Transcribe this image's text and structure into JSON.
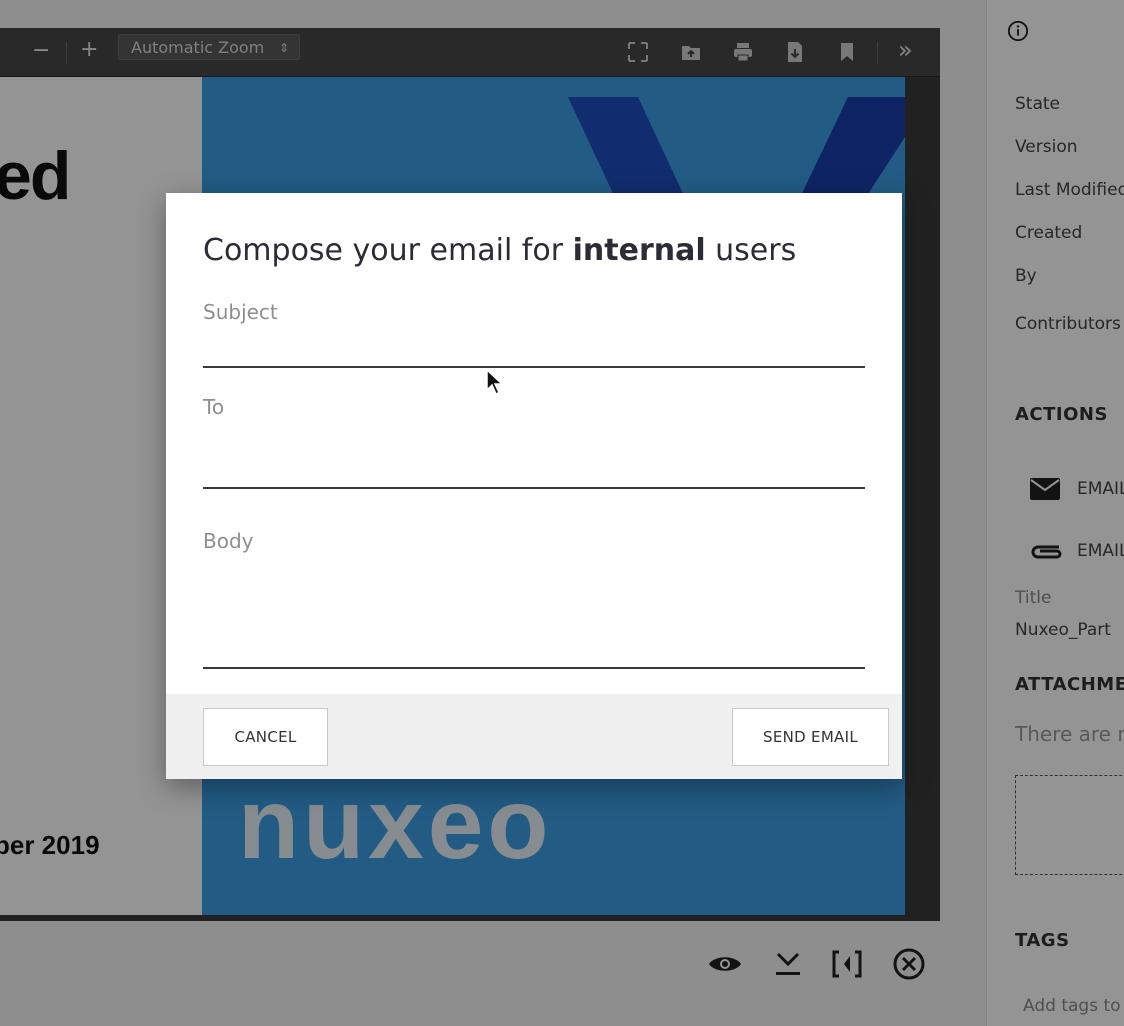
{
  "viewer": {
    "toolbar": {
      "zoom_out": "−",
      "zoom_in": "+",
      "zoom_select": "Automatic Zoom",
      "zoom_chevron": "⇕",
      "more": "»"
    },
    "document": {
      "heading_fragment": "ed",
      "date_fragment": "ber 2019",
      "logo_text": "nuxeo"
    }
  },
  "right_panel": {
    "fields": [
      "State",
      "Version",
      "Last Modified",
      "Created",
      "By",
      "Contributors"
    ],
    "actions_title": "ACTIONS",
    "actions": [
      {
        "icon": "mail-icon",
        "label": "EMAIL"
      },
      {
        "icon": "paperclip-icon",
        "label": "EMAIL"
      }
    ],
    "title_label": "Title",
    "title_value": "Nuxeo_Part",
    "attachments_title": "ATTACHME",
    "attachments_empty": "There are n",
    "tags_title": "TAGS",
    "tags_placeholder": "Add tags to"
  },
  "dialog": {
    "title_prefix": "Compose your email for ",
    "title_bold": "internal",
    "title_suffix": " users",
    "subject_label": "Subject",
    "subject_value": "",
    "to_label": "To",
    "to_value": "",
    "body_label": "Body",
    "body_value": "",
    "cancel_label": "CANCEL",
    "send_label": "SEND EMAIL"
  },
  "colors": {
    "accent_blue": "#3c9ee4",
    "overlay": "rgba(0,0,0,0.42)"
  }
}
